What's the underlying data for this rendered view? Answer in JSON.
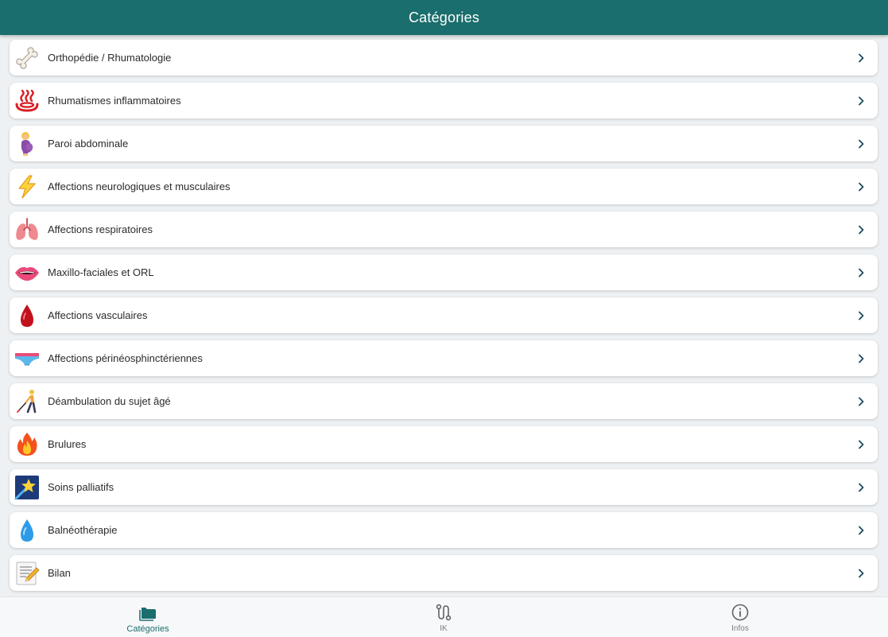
{
  "header": {
    "title": "Catégories"
  },
  "categories": [
    {
      "label": "Orthopédie / Rhumatologie",
      "icon": "bone-icon"
    },
    {
      "label": "Rhumatismes inflammatoires",
      "icon": "hot-springs-icon"
    },
    {
      "label": "Paroi abdominale",
      "icon": "pregnant-woman-icon"
    },
    {
      "label": "Affections neurologiques et musculaires",
      "icon": "lightning-icon"
    },
    {
      "label": "Affections respiratoires",
      "icon": "lungs-icon"
    },
    {
      "label": "Maxillo-faciales et ORL",
      "icon": "mouth-icon"
    },
    {
      "label": "Affections vasculaires",
      "icon": "blood-drop-icon"
    },
    {
      "label": "Affections périnéosphinctériennes",
      "icon": "briefs-icon"
    },
    {
      "label": "Déambulation du sujet âgé",
      "icon": "person-with-cane-icon"
    },
    {
      "label": "Brulures",
      "icon": "fire-icon"
    },
    {
      "label": "Soins palliatifs",
      "icon": "shooting-star-icon"
    },
    {
      "label": "Balnéothérapie",
      "icon": "water-drop-icon"
    },
    {
      "label": "Bilan",
      "icon": "memo-icon"
    }
  ],
  "tabbar": {
    "tabs": [
      {
        "label": "Catégories",
        "icon": "folder-icon",
        "active": true
      },
      {
        "label": "IK",
        "icon": "route-icon",
        "active": false
      },
      {
        "label": "Infos",
        "icon": "info-icon",
        "active": false
      }
    ]
  },
  "colors": {
    "primary": "#1a6e6d",
    "background": "#eef1f3",
    "inactive": "#7b8085"
  }
}
